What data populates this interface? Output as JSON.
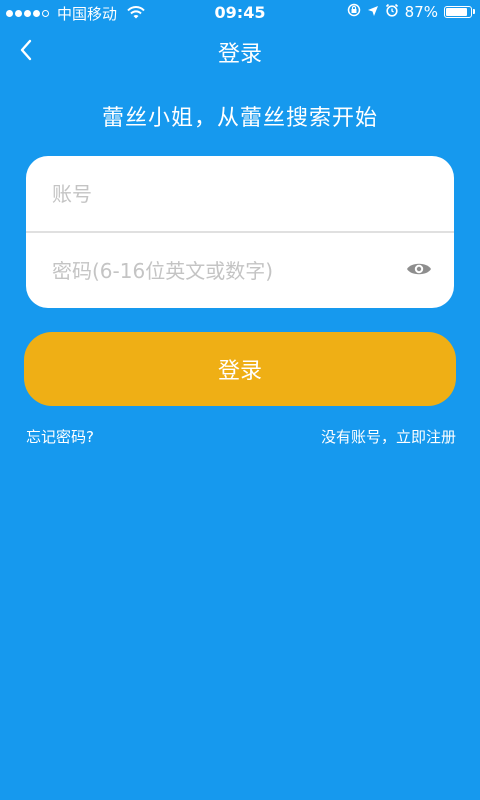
{
  "status_bar": {
    "carrier": "中国移动",
    "time": "09:45",
    "battery_text": "87%",
    "battery_level": 0.87,
    "signal_icon": "signal-dots-icon",
    "wifi_icon": "wifi-icon",
    "lock_icon": "rotation-lock-icon",
    "location_icon": "location-arrow-icon",
    "alarm_icon": "alarm-clock-icon"
  },
  "nav": {
    "back_icon": "chevron-left-icon",
    "title": "登录"
  },
  "slogan": "蕾丝小姐，从蕾丝搜索开始",
  "form": {
    "account_placeholder": "账号",
    "account_value": "",
    "password_placeholder": "密码(6-16位英文或数字)",
    "password_value": "",
    "toggle_icon": "eye-icon"
  },
  "login_button": {
    "label": "登录"
  },
  "links": {
    "forgot": "忘记密码?",
    "register": "没有账号，立即注册"
  },
  "colors": {
    "background": "#1699EE",
    "button": "#EFAF15",
    "card": "#FFFFFF",
    "placeholder": "#C4C4C4"
  }
}
